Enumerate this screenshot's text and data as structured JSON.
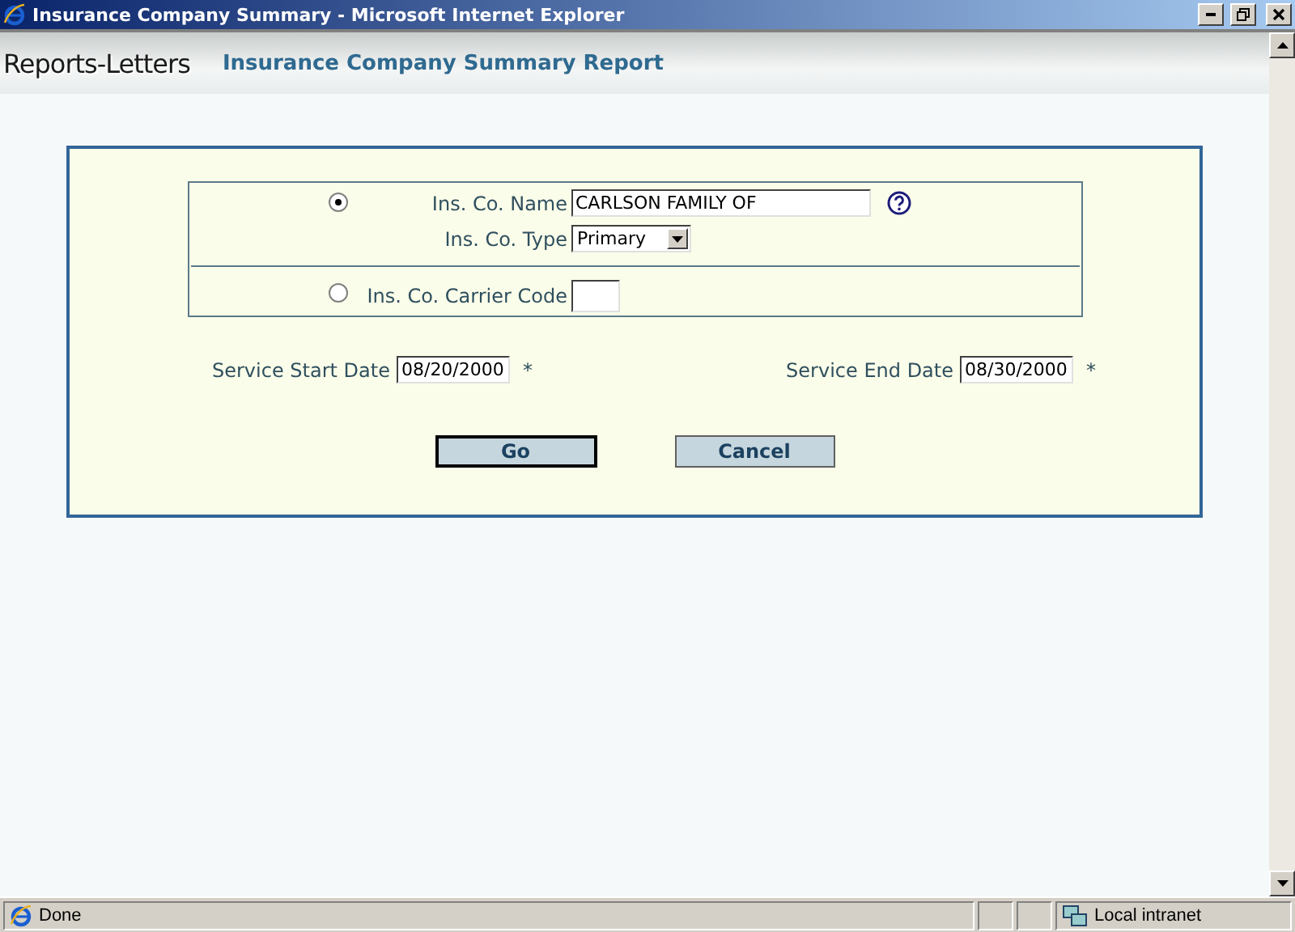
{
  "window": {
    "title": "Insurance Company Summary - Microsoft Internet Explorer"
  },
  "header": {
    "brand": "Reports-Letters",
    "title": "Insurance Company Summary Report"
  },
  "search_options": [
    {
      "selected": true,
      "fields": [
        {
          "kind": "text",
          "label": "Ins. Co. Name",
          "value": "CARLSON FAMILY OF",
          "help": true
        },
        {
          "kind": "select",
          "label": "Ins. Co. Type",
          "value": "Primary"
        }
      ]
    },
    {
      "selected": false,
      "fields": [
        {
          "kind": "code",
          "label": "Ins. Co. Carrier Code"
        }
      ]
    }
  ],
  "dates": [
    {
      "label": "Service Start Date",
      "value": "08/20/2000",
      "required_mark": "*"
    },
    {
      "label": "Service End Date",
      "value": "08/30/2000",
      "required_mark": "*"
    }
  ],
  "buttons": [
    {
      "label": "Go",
      "default": true
    },
    {
      "label": "Cancel",
      "default": false
    }
  ],
  "status_bar": {
    "text": "Done",
    "zone": "Local intranet"
  }
}
